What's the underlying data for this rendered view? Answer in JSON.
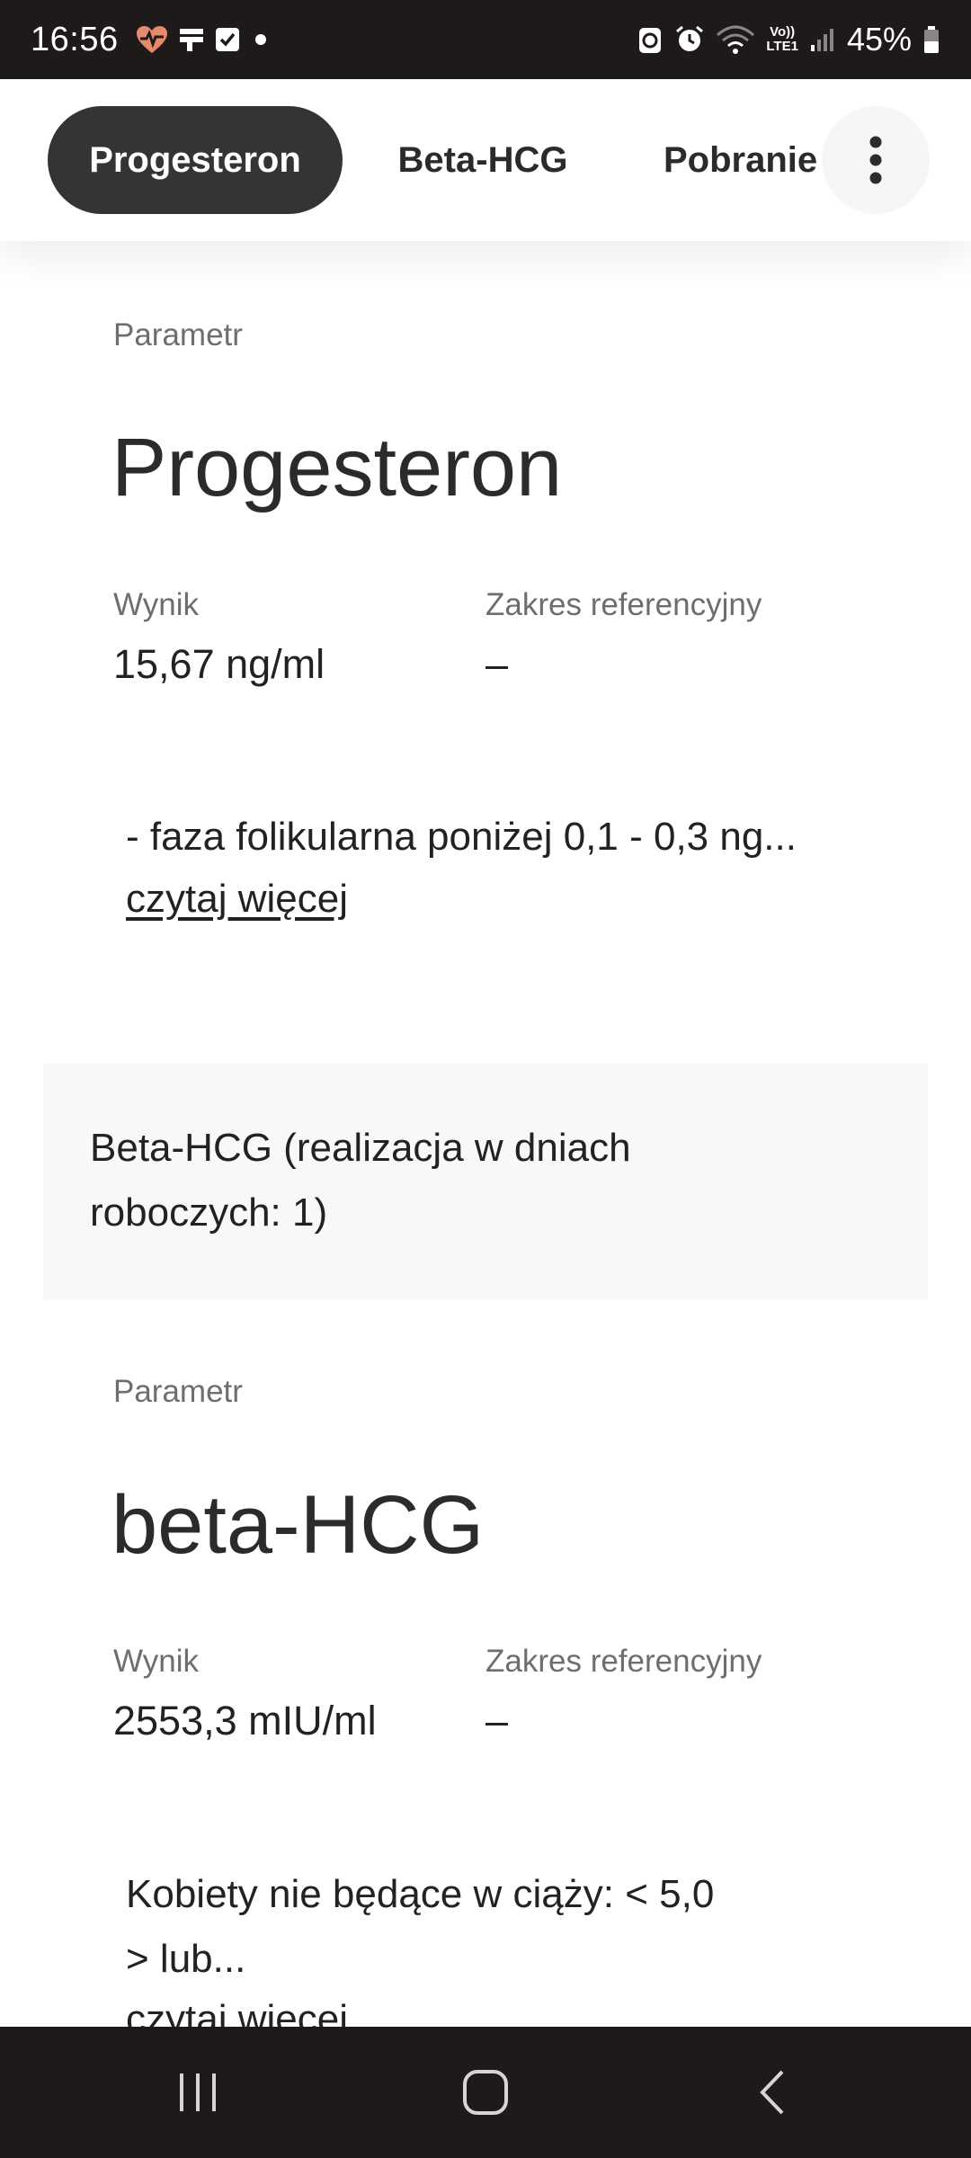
{
  "status_bar": {
    "time": "16:56",
    "battery": "45%",
    "left_icons": [
      "health-icon",
      "notification-icon",
      "checkbox-icon",
      "dot-icon"
    ],
    "right_icons": [
      "recycle-icon",
      "alarm-icon",
      "wifi-icon",
      "volte-lte-icon",
      "signal-icon",
      "battery-icon"
    ],
    "volte_label": "Vo))",
    "lte_label": "LTE1"
  },
  "tabs": [
    {
      "label": "Progesteron",
      "active": true
    },
    {
      "label": "Beta-HCG",
      "active": false
    },
    {
      "label": "Pobranie",
      "active": false
    }
  ],
  "more_icon": "more-vertical-icon",
  "results": [
    {
      "param_label": "Parametr",
      "name": "Progesteron",
      "result_label": "Wynik",
      "result_value": "15,67 ng/ml",
      "range_label": "Zakres referencyjny",
      "range_value": "–",
      "description": "- faza folikularna poniżej 0,1 - 0,3 ng...",
      "read_more": "czytaj więcej"
    },
    {
      "section_title": "Beta-HCG (realizacja w dniach roboczych: 1)",
      "param_label": "Parametr",
      "name": "beta-HCG",
      "result_label": "Wynik",
      "result_value": "2553,3 mIU/ml",
      "range_label": "Zakres referencyjny",
      "range_value": "–",
      "description_line1": "Kobiety nie będące w ciąży: < 5,0",
      "description_line2": "> lub...",
      "read_more": "czytaj więcej"
    }
  ],
  "nav_bar": {
    "icons": [
      "recent-apps-icon",
      "home-icon",
      "back-icon"
    ]
  },
  "colors": {
    "status_bar_bg": "#1e1a1a",
    "active_tab_bg": "#343434",
    "section_bg": "#f9f8f7"
  }
}
